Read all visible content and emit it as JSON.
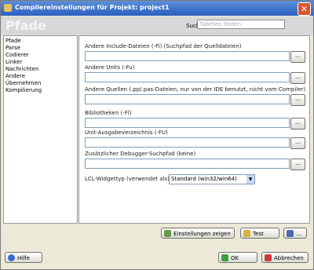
{
  "window": {
    "title": "Compilereinstellungen für Projekt: project1",
    "close_label": "✕"
  },
  "header": {
    "title": "Pfade",
    "search_label": "Suchen",
    "search_placeholder": "Tabellen finden"
  },
  "sidebar": {
    "items": [
      "Pfade",
      "Parse",
      "Codierer",
      "Linker",
      "Nachrichten",
      "Andere",
      "Übernehmen",
      "Kompilierung"
    ]
  },
  "content": {
    "fields": [
      {
        "label": "Andere Include-Dateien (-Fi) (Suchpfad der Quelldateien)",
        "button": "..."
      },
      {
        "label": "Andere Units (-Fu)",
        "button": "..."
      },
      {
        "label": "Andere Quellen (.pp/.pas-Dateien, nur von der IDE benutzt, nicht vom Compiler)",
        "button": "..."
      },
      {
        "label": "Bibliotheken (-Fl)",
        "button": "..."
      },
      {
        "label": "Unit-Ausgabeverzeichnis (-FU)",
        "button": "..."
      },
      {
        "label": "Zusätzlicher Debugger-Suchpfad (keine)",
        "button": "..."
      }
    ],
    "lcl_label": "LCL-Widgettyp (verwendet als):",
    "lcl_value": "Standard (win32/win64)"
  },
  "buttons": {
    "export_settings": "Einstellungen zeigen",
    "test": "Test",
    "load_save": "...",
    "help": "Hilfe",
    "ok": "OK",
    "cancel": "Abbrechen"
  }
}
